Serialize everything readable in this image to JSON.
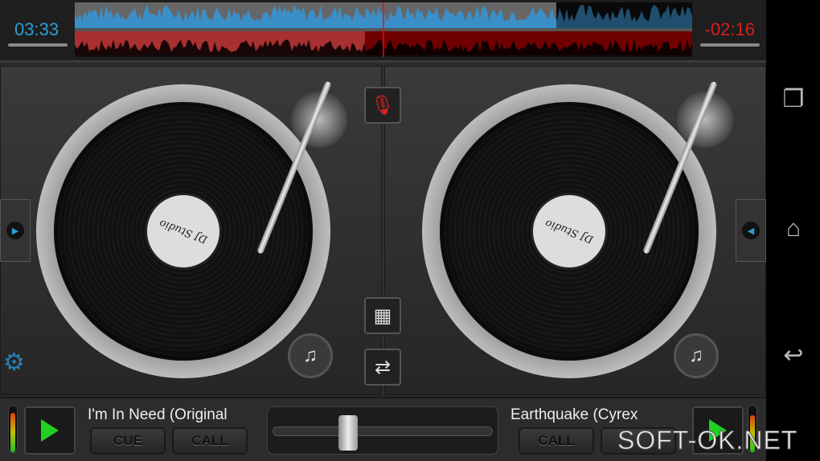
{
  "header": {
    "elapsed": "03:33",
    "remaining": "-02:16"
  },
  "deck_left": {
    "track_title": "I'm In Need (Original",
    "cue_label": "CUE",
    "call_label": "CALL",
    "record_label": "DJ Studio",
    "level": 0.85
  },
  "deck_right": {
    "track_title": "Earthquake (Cyrex",
    "call_label": "CALL",
    "level": 0.8
  },
  "crossfader": {
    "position": 0.35
  },
  "progress": {
    "left_track": 0.78,
    "right_track": 0.47
  },
  "colors": {
    "blue": "#2a9fd6",
    "red": "#d42020",
    "green": "#22d022"
  },
  "watermark": "SOFT-OK.NET"
}
